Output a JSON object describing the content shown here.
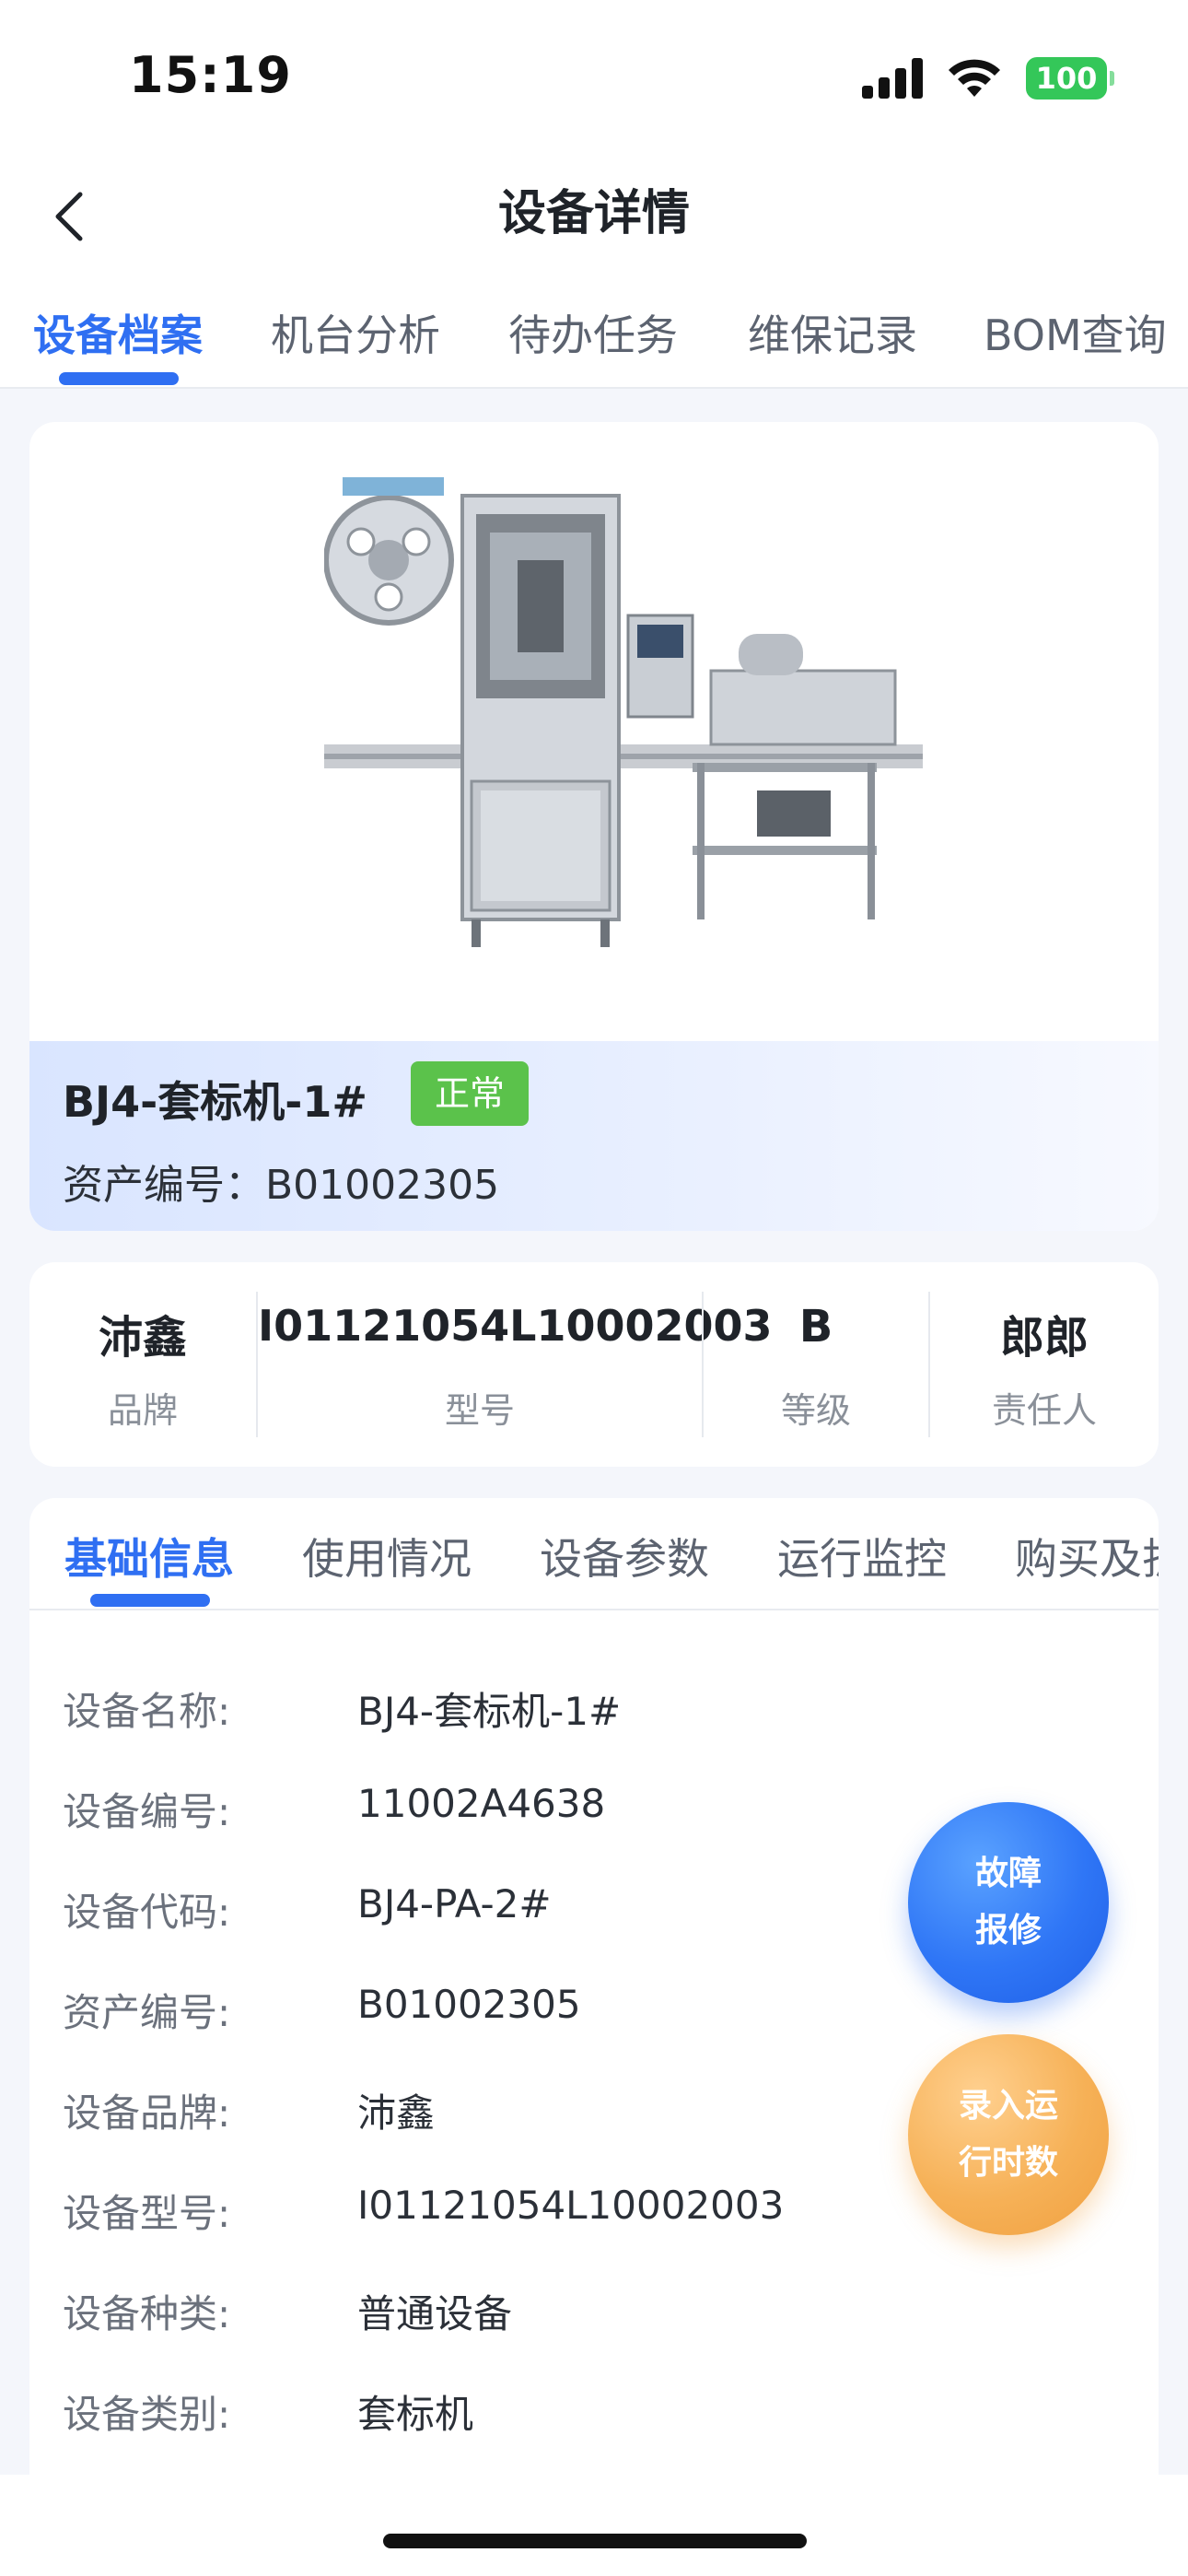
{
  "status_bar": {
    "time": "15:19",
    "battery": "100"
  },
  "nav": {
    "title": "设备详情"
  },
  "top_tabs": [
    {
      "label": "设备档案"
    },
    {
      "label": "机台分析"
    },
    {
      "label": "待办任务"
    },
    {
      "label": "维保记录"
    },
    {
      "label": "BOM查询"
    }
  ],
  "device": {
    "name": "BJ4-套标机-1#",
    "status": "正常",
    "asset_line": "资产编号：B01002305"
  },
  "summary": [
    {
      "value": "沛鑫",
      "label": "品牌"
    },
    {
      "value": "I01121054L10002003",
      "label": "型号"
    },
    {
      "value": "B",
      "label": "等级"
    },
    {
      "value": "郎郎",
      "label": "责任人"
    }
  ],
  "sub_tabs": [
    {
      "label": "基础信息"
    },
    {
      "label": "使用情况"
    },
    {
      "label": "设备参数"
    },
    {
      "label": "运行监控"
    },
    {
      "label": "购买及折"
    }
  ],
  "info_rows": [
    {
      "label": "设备名称:",
      "value": "BJ4-套标机-1#"
    },
    {
      "label": "设备编号:",
      "value": "11002A4638"
    },
    {
      "label": "设备代码:",
      "value": "BJ4-PA-2#"
    },
    {
      "label": "资产编号:",
      "value": "B01002305"
    },
    {
      "label": "设备品牌:",
      "value": "沛鑫"
    },
    {
      "label": "设备型号:",
      "value": "I01121054L10002003"
    },
    {
      "label": "设备种类:",
      "value": "普通设备"
    },
    {
      "label": "设备类别:",
      "value": "套标机"
    }
  ],
  "fab": {
    "repair_line1": "故障",
    "repair_line2": "报修",
    "runtime_line1": "录入运",
    "runtime_line2": "行时数"
  },
  "colors": {
    "accent": "#2f6ff2",
    "status_ok": "#5bc24b",
    "fab_orange": "#f6b157"
  }
}
